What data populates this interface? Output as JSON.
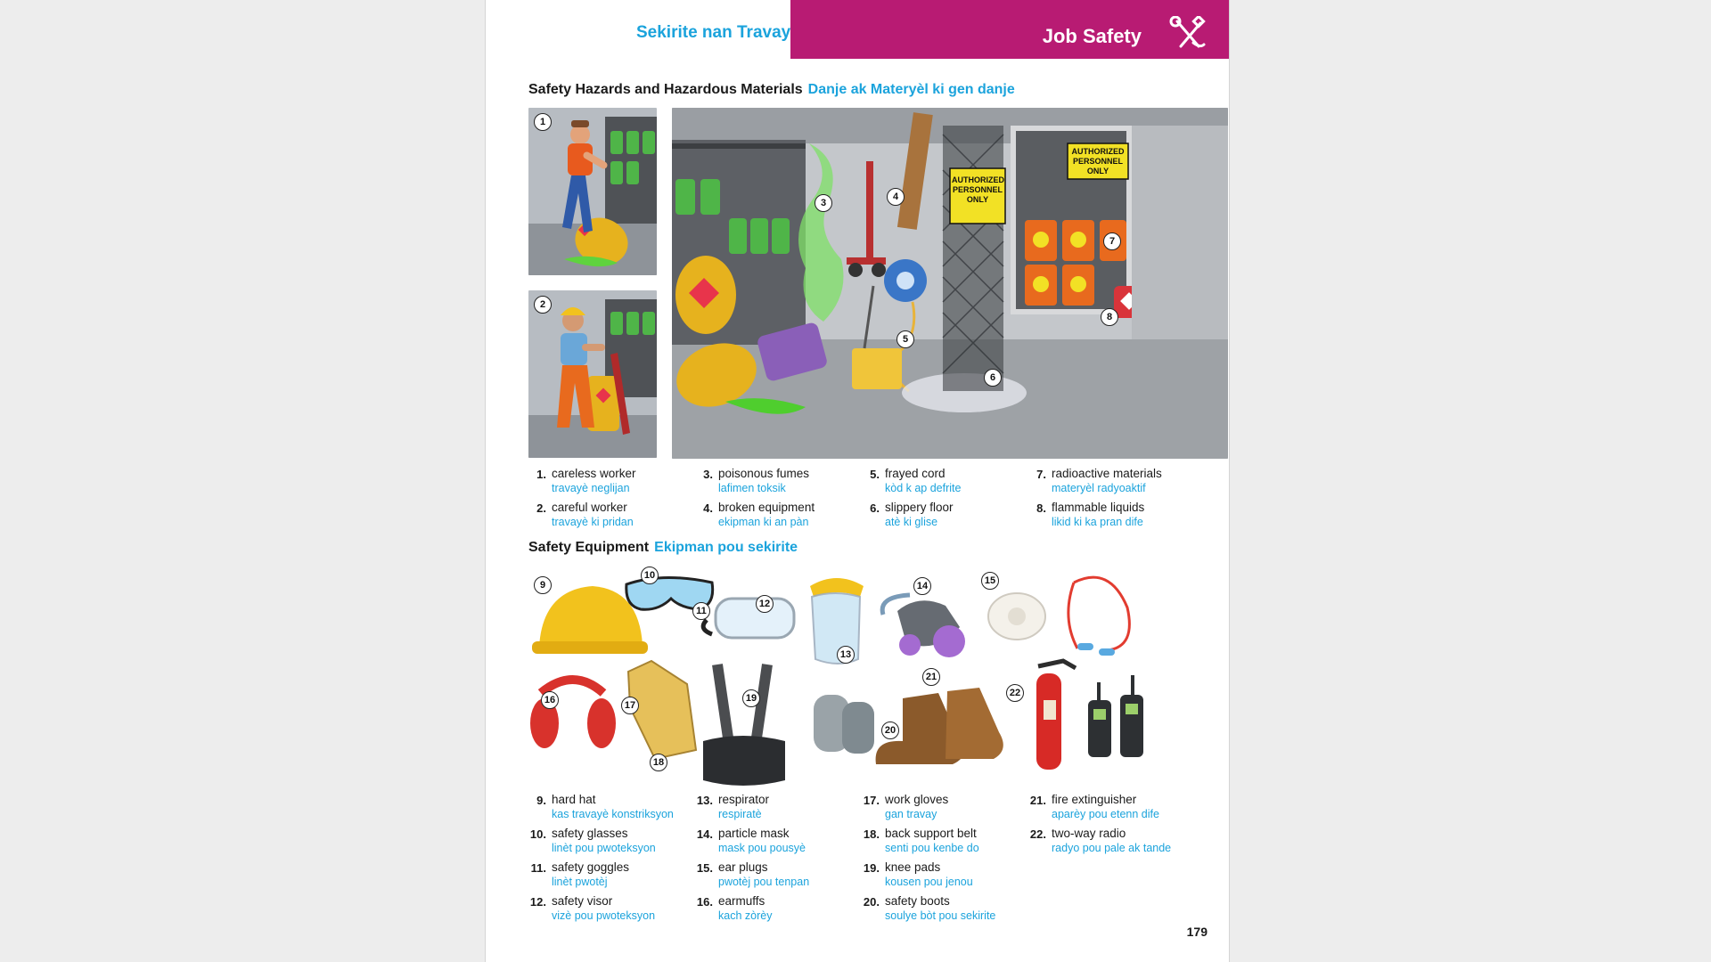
{
  "header": {
    "kreyol_title": "Sekirite nan Travay",
    "english_title": "Job Safety"
  },
  "section1": {
    "title_en": "Safety Hazards and Hazardous Materials",
    "title_ht": "Danje ak Materyèl ki gen danje",
    "sign_text": "AUTHORIZED PERSONNEL ONLY",
    "items": [
      {
        "num": "1.",
        "en": "careless worker",
        "ht": "travayè neglijan"
      },
      {
        "num": "2.",
        "en": "careful worker",
        "ht": "travayè ki pridan"
      },
      {
        "num": "3.",
        "en": "poisonous fumes",
        "ht": "lafimen toksik"
      },
      {
        "num": "4.",
        "en": "broken equipment",
        "ht": "ekipman ki an pàn"
      },
      {
        "num": "5.",
        "en": "frayed cord",
        "ht": "kòd k ap defrite"
      },
      {
        "num": "6.",
        "en": "slippery floor",
        "ht": "atè ki glise"
      },
      {
        "num": "7.",
        "en": "radioactive materials",
        "ht": "materyèl radyoaktif"
      },
      {
        "num": "8.",
        "en": "flammable liquids",
        "ht": "likid ki ka pran dife"
      }
    ]
  },
  "section2": {
    "title_en": "Safety Equipment",
    "title_ht": "Ekipman pou sekirite",
    "items": [
      {
        "num": "9.",
        "en": "hard hat",
        "ht": "kas travayè konstriksyon"
      },
      {
        "num": "10.",
        "en": "safety glasses",
        "ht": "linèt pou pwoteksyon"
      },
      {
        "num": "11.",
        "en": "safety goggles",
        "ht": "linèt pwotèj"
      },
      {
        "num": "12.",
        "en": "safety visor",
        "ht": "vizè pou pwoteksyon"
      },
      {
        "num": "13.",
        "en": "respirator",
        "ht": "respiratè"
      },
      {
        "num": "14.",
        "en": "particle mask",
        "ht": "mask pou pousyè"
      },
      {
        "num": "15.",
        "en": "ear plugs",
        "ht": "pwotèj pou tenpan"
      },
      {
        "num": "16.",
        "en": "earmuffs",
        "ht": "kach zòrèy"
      },
      {
        "num": "17.",
        "en": "work gloves",
        "ht": "gan travay"
      },
      {
        "num": "18.",
        "en": "back support belt",
        "ht": "senti pou kenbe do"
      },
      {
        "num": "19.",
        "en": "knee pads",
        "ht": "kousen pou jenou"
      },
      {
        "num": "20.",
        "en": "safety boots",
        "ht": "soulye bòt pou sekirite"
      },
      {
        "num": "21.",
        "en": "fire extinguisher",
        "ht": "aparèy pou etenn dife"
      },
      {
        "num": "22.",
        "en": "two-way radio",
        "ht": "radyo pou pale ak tande"
      }
    ]
  },
  "callouts": [
    "1",
    "2",
    "3",
    "4",
    "5",
    "6",
    "7",
    "8",
    "9",
    "10",
    "11",
    "12",
    "13",
    "14",
    "15",
    "16",
    "17",
    "18",
    "19",
    "20",
    "21",
    "22"
  ],
  "page_number": "179",
  "colors": {
    "accent_blue": "#1ba3dc",
    "header_magenta": "#b81b73"
  },
  "icons": [
    "wrench-screwdriver-icon"
  ]
}
